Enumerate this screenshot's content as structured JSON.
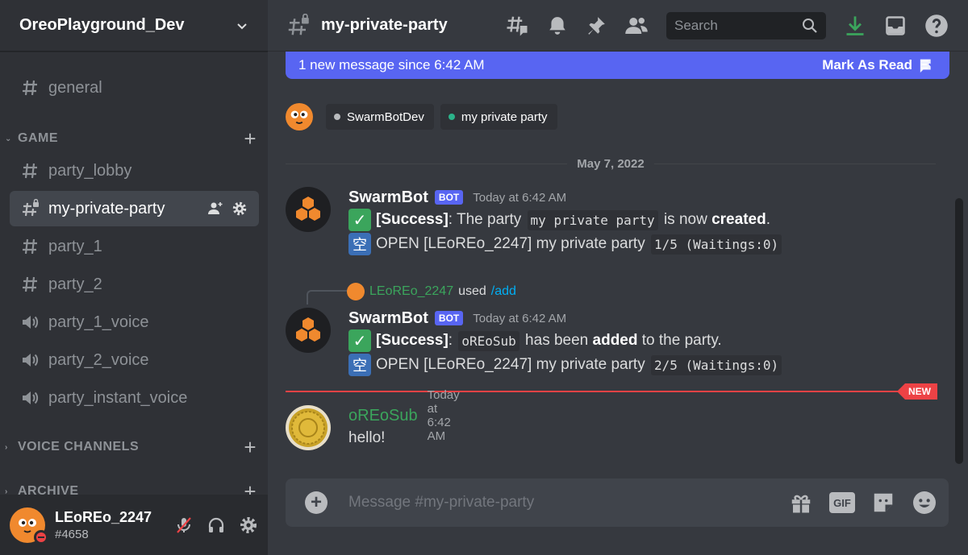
{
  "server": {
    "name": "OreoPlayground_Dev"
  },
  "channels": {
    "general": "general",
    "game_category": "GAME",
    "party_lobby": "party_lobby",
    "my_private_party": "my-private-party",
    "party_1": "party_1",
    "party_2": "party_2",
    "party_1_voice": "party_1_voice",
    "party_2_voice": "party_2_voice",
    "party_instant_voice": "party_instant_voice",
    "voice_category": "VOICE CHANNELS",
    "archive_category": "ARCHIVE"
  },
  "user": {
    "name": "LEoREo_2247",
    "discriminator": "#4658"
  },
  "header": {
    "channel": "my-private-party",
    "search_placeholder": "Search"
  },
  "banner": {
    "text": "1 new message since 6:42 AM",
    "action": "Mark As Read"
  },
  "chips": [
    {
      "label": "SwarmBotDev",
      "color": "#b9bbbe"
    },
    {
      "label": "my private party",
      "color": "#2bb38a"
    }
  ],
  "date_divider": "May 7, 2022",
  "messages": [
    {
      "author": "SwarmBot",
      "tag": "BOT",
      "time": "Today at 6:42 AM",
      "line1": {
        "bold": "[Success]",
        "pre": ": The party ",
        "code": "my private party",
        "mid": " is now ",
        "strong": "created",
        "end": "."
      },
      "line2": {
        "kanji": "空",
        "text": "OPEN [LEoREo_2247] my private party ",
        "code": "1/5 (Waitings:0)"
      }
    },
    {
      "author": "SwarmBot",
      "tag": "BOT",
      "time": "Today at 6:42 AM",
      "reply": {
        "name": "LEoREo_2247",
        "used": "used",
        "command": "/add"
      },
      "line1": {
        "bold": "[Success]",
        "pre": ": ",
        "code": "oREoSub",
        "mid": " has been ",
        "strong": "added",
        "end": " to the party."
      },
      "line2": {
        "kanji": "空",
        "text": "OPEN [LEoREo_2247] my private party ",
        "code": "2/5 (Waitings:0)"
      }
    },
    {
      "author": "oREoSub",
      "time": "Today at 6:42 AM",
      "text": "hello!",
      "author_color": "#3ba55c"
    }
  ],
  "new_badge": "NEW",
  "composer": {
    "placeholder": "Message #my-private-party",
    "gif": "GIF"
  },
  "colors": {
    "accent": "#5865f2",
    "sidebar": "#2f3136",
    "main": "#36393f",
    "new": "#ed4245"
  }
}
